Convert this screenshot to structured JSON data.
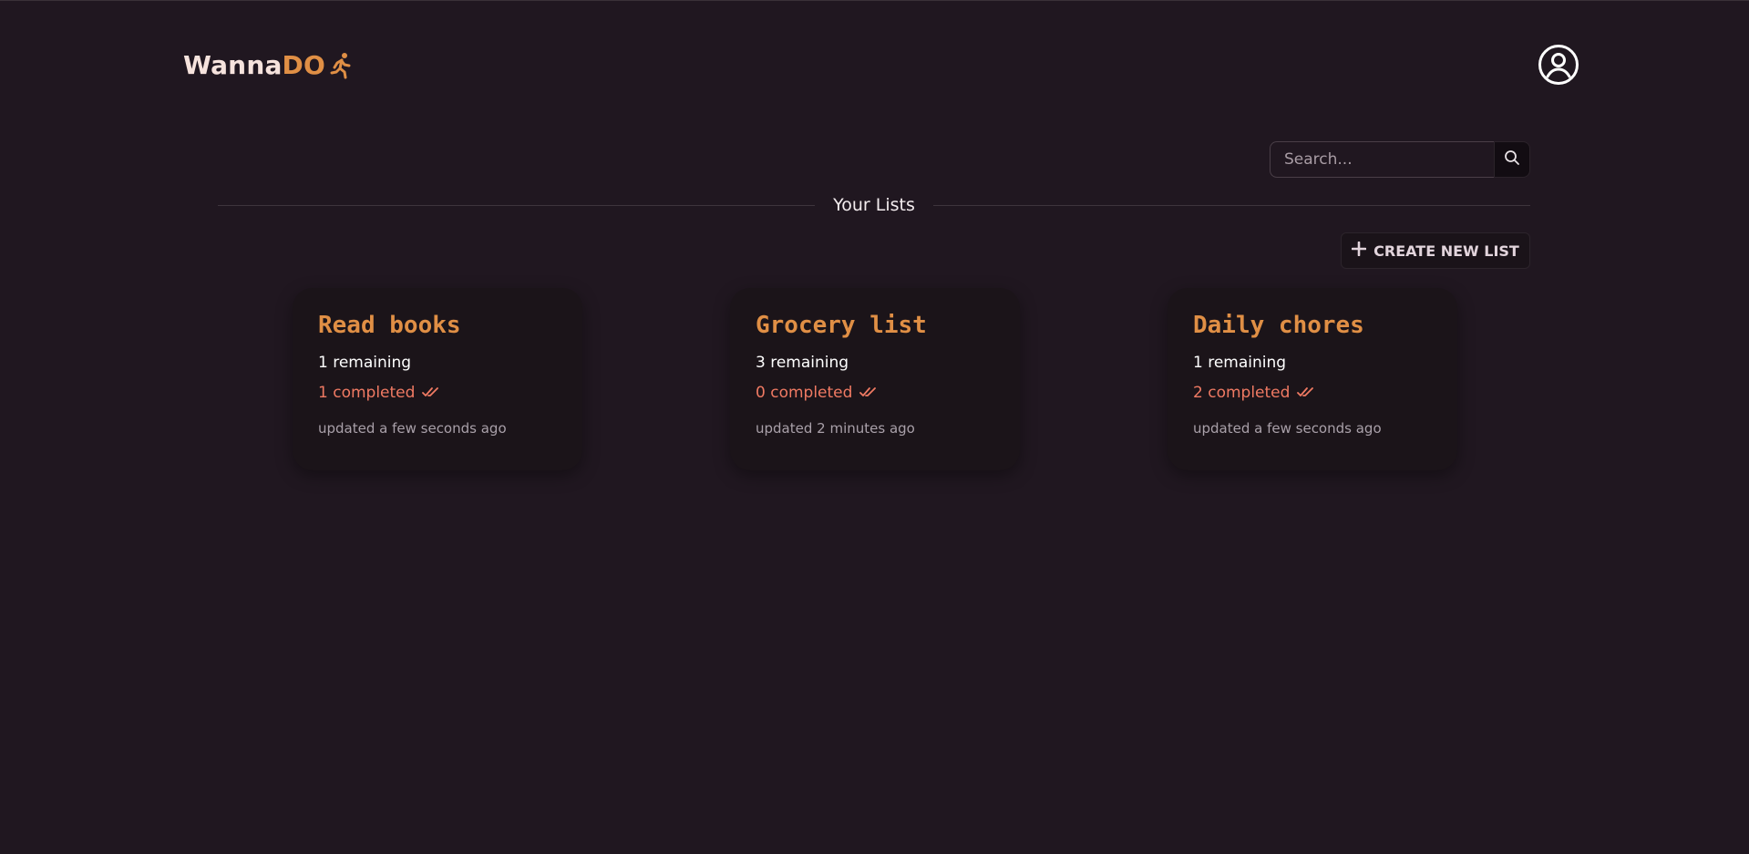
{
  "header": {
    "brand_first": "Wanna",
    "brand_second": "DO",
    "brand_icon": "running-person-icon",
    "account_icon": "user-circle-icon",
    "accent_color": "#e08f45"
  },
  "search": {
    "placeholder": "Search...",
    "value": "",
    "icon": "search-icon"
  },
  "section": {
    "title": "Your Lists"
  },
  "toolbar": {
    "create_label": "CREATE NEW LIST",
    "create_icon": "plus-icon"
  },
  "lists": [
    {
      "title": "Read books",
      "remaining": "1 remaining",
      "completed": "1 completed",
      "updated": "updated a few seconds ago"
    },
    {
      "title": "Grocery list",
      "remaining": "3 remaining",
      "completed": "0 completed",
      "updated": "updated 2 minutes ago"
    },
    {
      "title": "Daily chores",
      "remaining": "1 remaining",
      "completed": "2 completed",
      "updated": "updated a few seconds ago"
    }
  ]
}
